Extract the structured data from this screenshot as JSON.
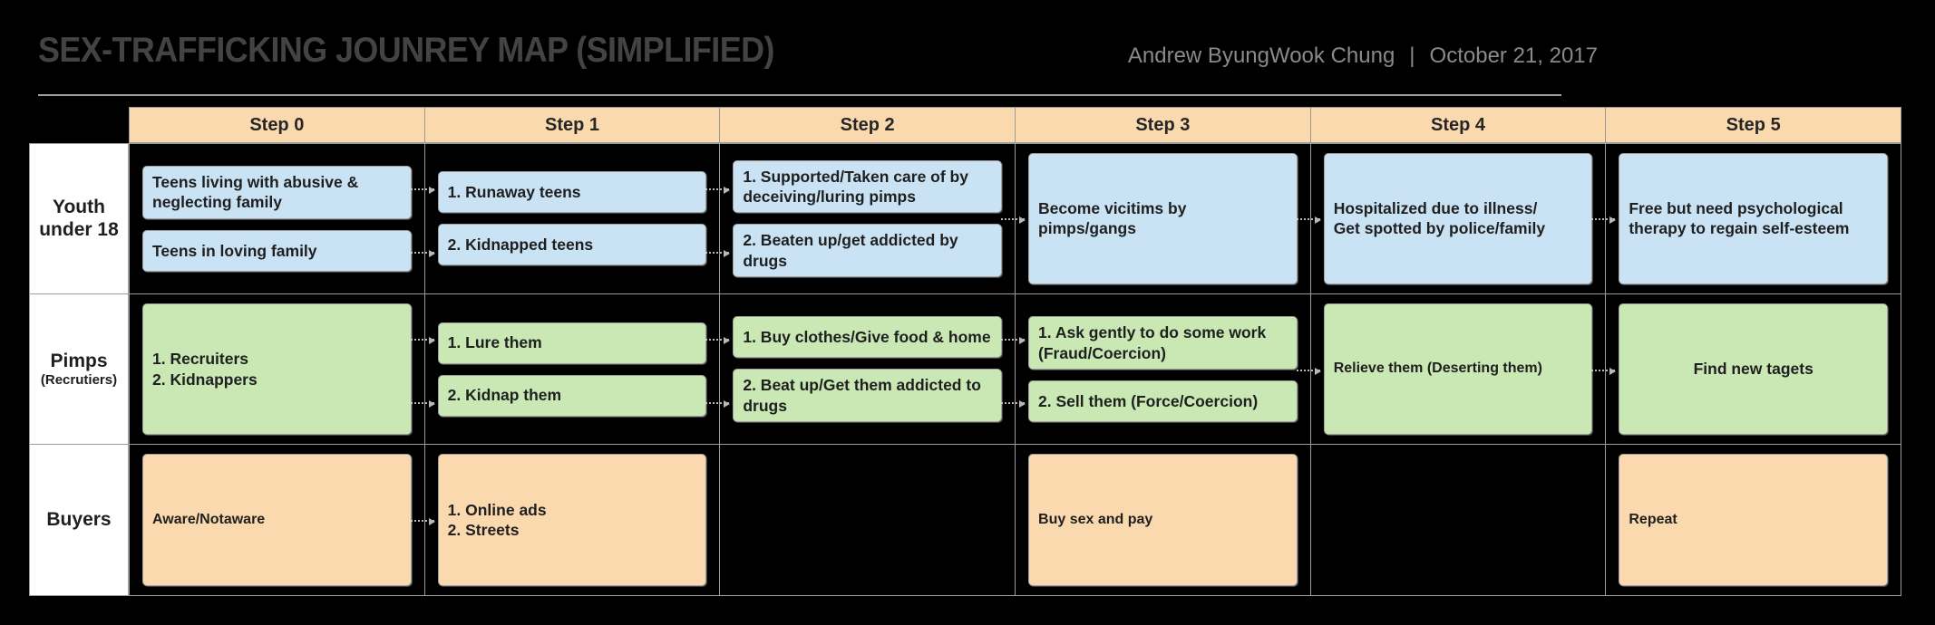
{
  "header": {
    "title": "SEX-TRAFFICKING JOUNREY MAP (SIMPLIFIED)",
    "author": "Andrew ByungWook Chung",
    "separator": "|",
    "date": "October 21, 2017"
  },
  "colors": {
    "background": "#000000",
    "title_text": "#434343",
    "byline_text": "#8a8a8a",
    "step_header_fill": "#fbd9ae",
    "youth_card_fill": "#c9e3f5",
    "pimps_card_fill": "#c9e8b4",
    "buyers_card_fill": "#fbd9ae",
    "grid_line": "#9b9b9b",
    "lane_label_fill": "#ffffff"
  },
  "steps": [
    {
      "label": "Step 0"
    },
    {
      "label": "Step 1"
    },
    {
      "label": "Step 2"
    },
    {
      "label": "Step 3"
    },
    {
      "label": "Step 4"
    },
    {
      "label": "Step 5"
    }
  ],
  "lanes": [
    {
      "name_line1": "Youth",
      "name_line2": "under 18",
      "sub": "",
      "cells": [
        {
          "cards": [
            {
              "text": "Teens living with abusive & neglecting family",
              "size": "half",
              "align": "left"
            },
            {
              "text": "Teens in loving family",
              "size": "half",
              "align": "left"
            }
          ]
        },
        {
          "cards": [
            {
              "text": "1. Runaway teens",
              "size": "half",
              "align": "left"
            },
            {
              "text": "2. Kidnapped teens",
              "size": "half",
              "align": "left"
            }
          ]
        },
        {
          "cards": [
            {
              "text": "1. Supported/Taken care of by deceiving/luring pimps",
              "size": "half",
              "align": "left"
            },
            {
              "text": "2. Beaten up/get addicted by drugs",
              "size": "half",
              "align": "left"
            }
          ]
        },
        {
          "cards": [
            {
              "text": "Become vicitims by\npimps/gangs",
              "size": "full",
              "align": "left"
            }
          ]
        },
        {
          "cards": [
            {
              "text": "Hospitalized due to illness/\nGet spotted by police/family",
              "size": "full",
              "align": "left"
            }
          ]
        },
        {
          "cards": [
            {
              "text": "Free but need psychological\ntherapy to regain self-esteem",
              "size": "full",
              "align": "left"
            }
          ]
        }
      ]
    },
    {
      "name_line1": "Pimps",
      "name_line2": "",
      "sub": "(Recrutiers)",
      "cells": [
        {
          "cards": [
            {
              "text": "1. Recruiters\n2. Kidnappers",
              "size": "full",
              "align": "left"
            }
          ]
        },
        {
          "cards": [
            {
              "text": "1. Lure them",
              "size": "half",
              "align": "left"
            },
            {
              "text": "2. Kidnap them",
              "size": "half",
              "align": "left"
            }
          ]
        },
        {
          "cards": [
            {
              "text": "1. Buy clothes/Give food & home",
              "size": "half",
              "align": "left"
            },
            {
              "text": "2. Beat up/Get them addicted to drugs",
              "size": "half",
              "align": "left"
            }
          ]
        },
        {
          "cards": [
            {
              "text": "1. Ask gently to do some work\n    (Fraud/Coercion)",
              "size": "half",
              "align": "left"
            },
            {
              "text": "2. Sell them (Force/Coercion)",
              "size": "half",
              "align": "left"
            }
          ]
        },
        {
          "cards": [
            {
              "text": "Relieve them (Deserting them)",
              "size": "full",
              "align": "left",
              "small": true
            }
          ]
        },
        {
          "cards": [
            {
              "text": "Find new tagets",
              "size": "full",
              "align": "center"
            }
          ]
        }
      ]
    },
    {
      "name_line1": "Buyers",
      "name_line2": "",
      "sub": "",
      "cells": [
        {
          "cards": [
            {
              "text": "Aware/Notaware",
              "size": "full",
              "align": "left",
              "small": true
            }
          ]
        },
        {
          "cards": [
            {
              "text": "1. Online ads\n2. Streets",
              "size": "full",
              "align": "left"
            }
          ]
        },
        {
          "cards": []
        },
        {
          "cards": [
            {
              "text": "Buy sex and pay",
              "size": "full",
              "align": "left",
              "small": true
            }
          ]
        },
        {
          "cards": []
        },
        {
          "cards": [
            {
              "text": "Repeat",
              "size": "full",
              "align": "left",
              "small": true
            }
          ]
        }
      ]
    }
  ]
}
